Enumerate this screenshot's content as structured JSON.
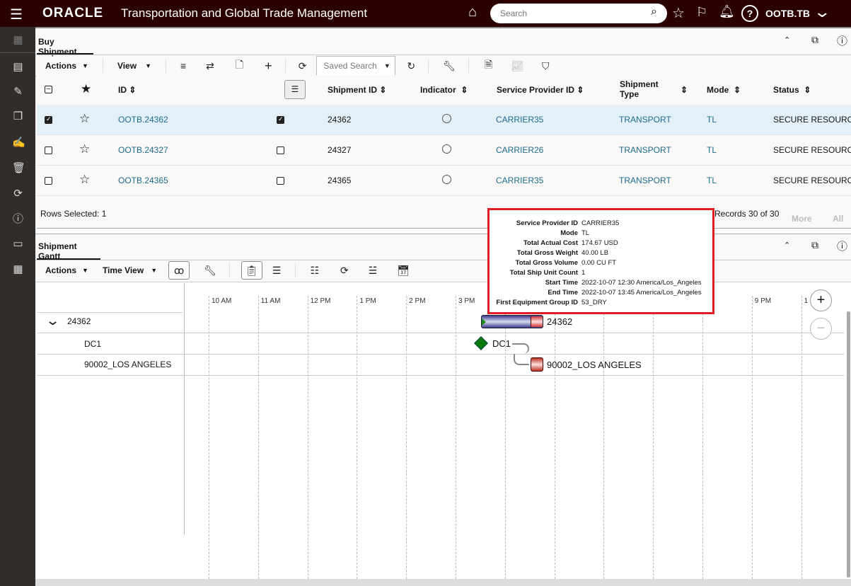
{
  "header": {
    "brand": "ORACLE",
    "title": "Transportation and Global Trade Management",
    "search_placeholder": "Search",
    "user": "OOTB.TB",
    "color": "#2a0100"
  },
  "sidebar": {
    "icons": [
      "dashboard-icon",
      "layout-icon",
      "edit-form-icon",
      "copy-icon",
      "edit-doc-icon",
      "trash-icon",
      "refresh-icon",
      "info-icon",
      "monitor-icon",
      "grid-search-icon"
    ]
  },
  "buy_shipment": {
    "tab": "Buy Shipment",
    "toolbar": {
      "actions": "Actions",
      "view": "View",
      "saved_search": "Saved Search"
    },
    "columns": [
      "ID",
      "Shipment ID",
      "Indicator",
      "Service Provider ID",
      "Shipment Type",
      "Mode",
      "Status"
    ],
    "rows": [
      {
        "id": "OOTB.24362",
        "shipment_id": "24362",
        "provider": "CARRIER35",
        "type": "TRANSPORT",
        "mode": "TL",
        "status": "SECURE RESOURC",
        "selected": true,
        "gantt": true
      },
      {
        "id": "OOTB.24327",
        "shipment_id": "24327",
        "provider": "CARRIER26",
        "type": "TRANSPORT",
        "mode": "TL",
        "status": "SECURE RESOURC",
        "selected": false,
        "gantt": false
      },
      {
        "id": "OOTB.24365",
        "shipment_id": "24365",
        "provider": "CARRIER35",
        "type": "TRANSPORT",
        "mode": "TL",
        "status": "SECURE RESOURC",
        "selected": false,
        "gantt": false
      }
    ],
    "rows_selected": "Rows Selected: 1",
    "records": "Records 30 of 30",
    "more": "More",
    "all": "All"
  },
  "gantt": {
    "tab": "Shipment Gantt",
    "toolbar": {
      "actions": "Actions",
      "time_view": "Time View"
    },
    "ticks": [
      "10 AM",
      "11 AM",
      "12 PM",
      "1 PM",
      "2 PM",
      "3 PM",
      "",
      "",
      "",
      "",
      "",
      "9 PM",
      "1"
    ],
    "rows": [
      {
        "label": "24362",
        "bar_label": "24362"
      },
      {
        "label": "DC1",
        "bar_label": "DC1"
      },
      {
        "label": "90002_LOS ANGELES",
        "bar_label": "90002_LOS ANGELES"
      }
    ]
  },
  "tooltip": [
    {
      "k": "Service Provider ID",
      "v": "CARRIER35"
    },
    {
      "k": "Mode",
      "v": "TL"
    },
    {
      "k": "Total Actual Cost",
      "v": "174.67 USD"
    },
    {
      "k": "Total Gross Weight",
      "v": "40.00 LB"
    },
    {
      "k": "Total Gross Volume",
      "v": "0.00 CU FT"
    },
    {
      "k": "Total Ship Unit Count",
      "v": "1"
    },
    {
      "k": "Start Time",
      "v": "2022-10-07 12:30 America/Los_Angeles"
    },
    {
      "k": "End Time",
      "v": "2022-10-07 13:45 America/Los_Angeles"
    },
    {
      "k": "First Equipment Group ID",
      "v": "53_DRY"
    }
  ]
}
